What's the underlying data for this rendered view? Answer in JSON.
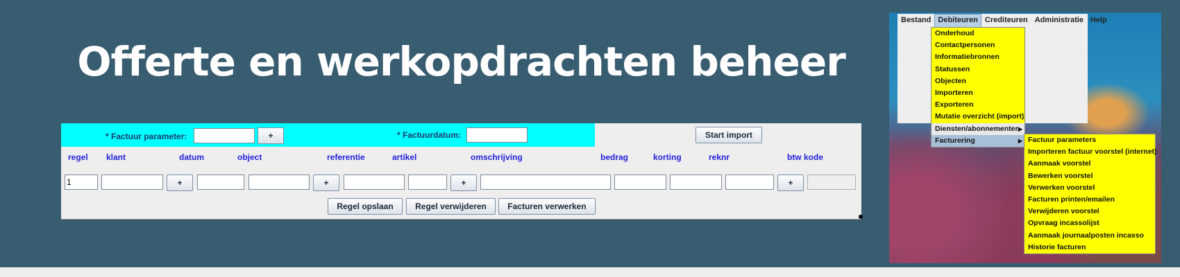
{
  "title": "Offerte en werkopdrachten beheer",
  "form": {
    "factuur_parameter_label": "*   Factuur parameter:",
    "factuurdatum_label": "*   Factuurdatum:",
    "plus": "+",
    "start_import": "Start import",
    "columns": [
      "regel",
      "klant",
      "datum",
      "object",
      "referentie",
      "artikel",
      "omschrijving",
      "bedrag",
      "korting",
      "reknr",
      "btw kode"
    ],
    "regel_value": "1",
    "buttons": {
      "save": "Regel opslaan",
      "delete": "Regel verwijderen",
      "process": "Facturen verwerken"
    }
  },
  "menu": {
    "bar": [
      "Bestand",
      "Debiteuren",
      "Crediteuren",
      "Administratie",
      "Help"
    ],
    "debiteuren_items": [
      "Onderhoud",
      "Contactpersonen",
      "Informatiebronnen",
      "Statussen",
      "Objecten",
      "Importeren",
      "Exporteren",
      "Mutatie overzicht (import)",
      "Diensten/abonnementen",
      "Facturering"
    ],
    "facturering_items": [
      "Factuur parameters",
      "Importeren factuur voorstel (internet)",
      "Aanmaak voorstel",
      "Bewerken voorstel",
      "Verwerken voorstel",
      "Facturen printen/emailen",
      "Verwijderen voorstel",
      "Opvraag incassolijst",
      "Aanmaak journaalposten incasso",
      "Historie facturen"
    ]
  },
  "colors": {
    "band": "#385c70",
    "cyan": "#00ffff",
    "menu_yellow": "#ffff00",
    "header_blue": "#2222dd"
  }
}
